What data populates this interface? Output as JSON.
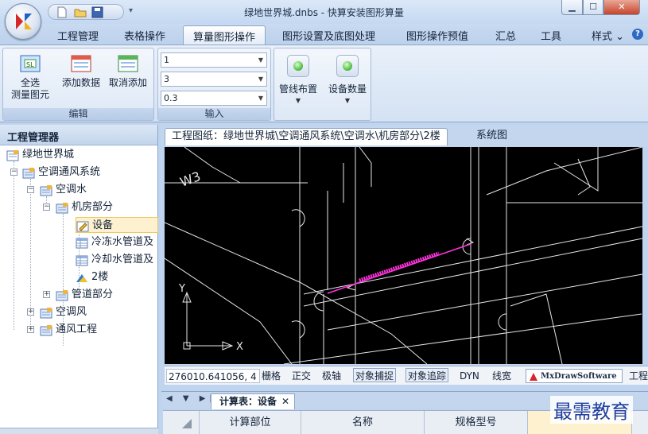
{
  "window": {
    "title": "绿地世界城.dnbs - 快算安装图形算量",
    "minimize": "▁",
    "maximize": "☐",
    "close": "✕"
  },
  "ribbon_tabs": [
    "工程管理",
    "表格操作",
    "算量图形操作",
    "图形设置及底图处理",
    "图形操作预值",
    "汇总",
    "工具"
  ],
  "style_menu": "样式 ⌄",
  "ribbon": {
    "edit_group": {
      "label": "编辑",
      "buttons": [
        {
          "line1": "全选",
          "line2": "测量图元"
        },
        {
          "line1": "添加数据",
          "line2": ""
        },
        {
          "line1": "取消添加",
          "line2": ""
        }
      ]
    },
    "input_group": {
      "label": "输入",
      "combos": [
        "1",
        "3",
        "0.3"
      ]
    },
    "pipe_button": "管线布置",
    "device_button": "设备数量"
  },
  "left_panel": {
    "title": "工程管理器",
    "tree": {
      "root": "绿地世界城",
      "hvac": "空调通风系统",
      "water": "空调水",
      "machine_room": "机房部分",
      "equipment": "设备",
      "chilled_pipe": "冷冻水管道及",
      "cooling_pipe": "冷却水管道及",
      "floor2": "2楼",
      "pipe_part": "管道部分",
      "aircon_wind": "空调风",
      "ventilation": "通风工程"
    }
  },
  "doc_tabs": {
    "drawing": "工程图纸：绿地世界城\\空调通风系统\\空调水\\机房部分\\2楼",
    "system": "系统图"
  },
  "canvas": {
    "y_axis": "Y",
    "x_axis": "X"
  },
  "statusbar": {
    "coord": "276010.641056, 4",
    "items": [
      "栅格",
      "正交",
      "极轴",
      "对象捕捉",
      "对象追踪",
      "DYN",
      "线宽"
    ],
    "logo": "MxDrawSoftware",
    "trailing": "工程"
  },
  "bottom": {
    "nav": "◀ ▼ ▶|",
    "tab": "计算表：设备",
    "tab_close": "✕",
    "headers": [
      "计算部位",
      "名称",
      "规格型号"
    ]
  },
  "watermark": "最需教育",
  "colors": {
    "selected_pipe": "#ff33dd",
    "accent": "#2e6ac5"
  }
}
